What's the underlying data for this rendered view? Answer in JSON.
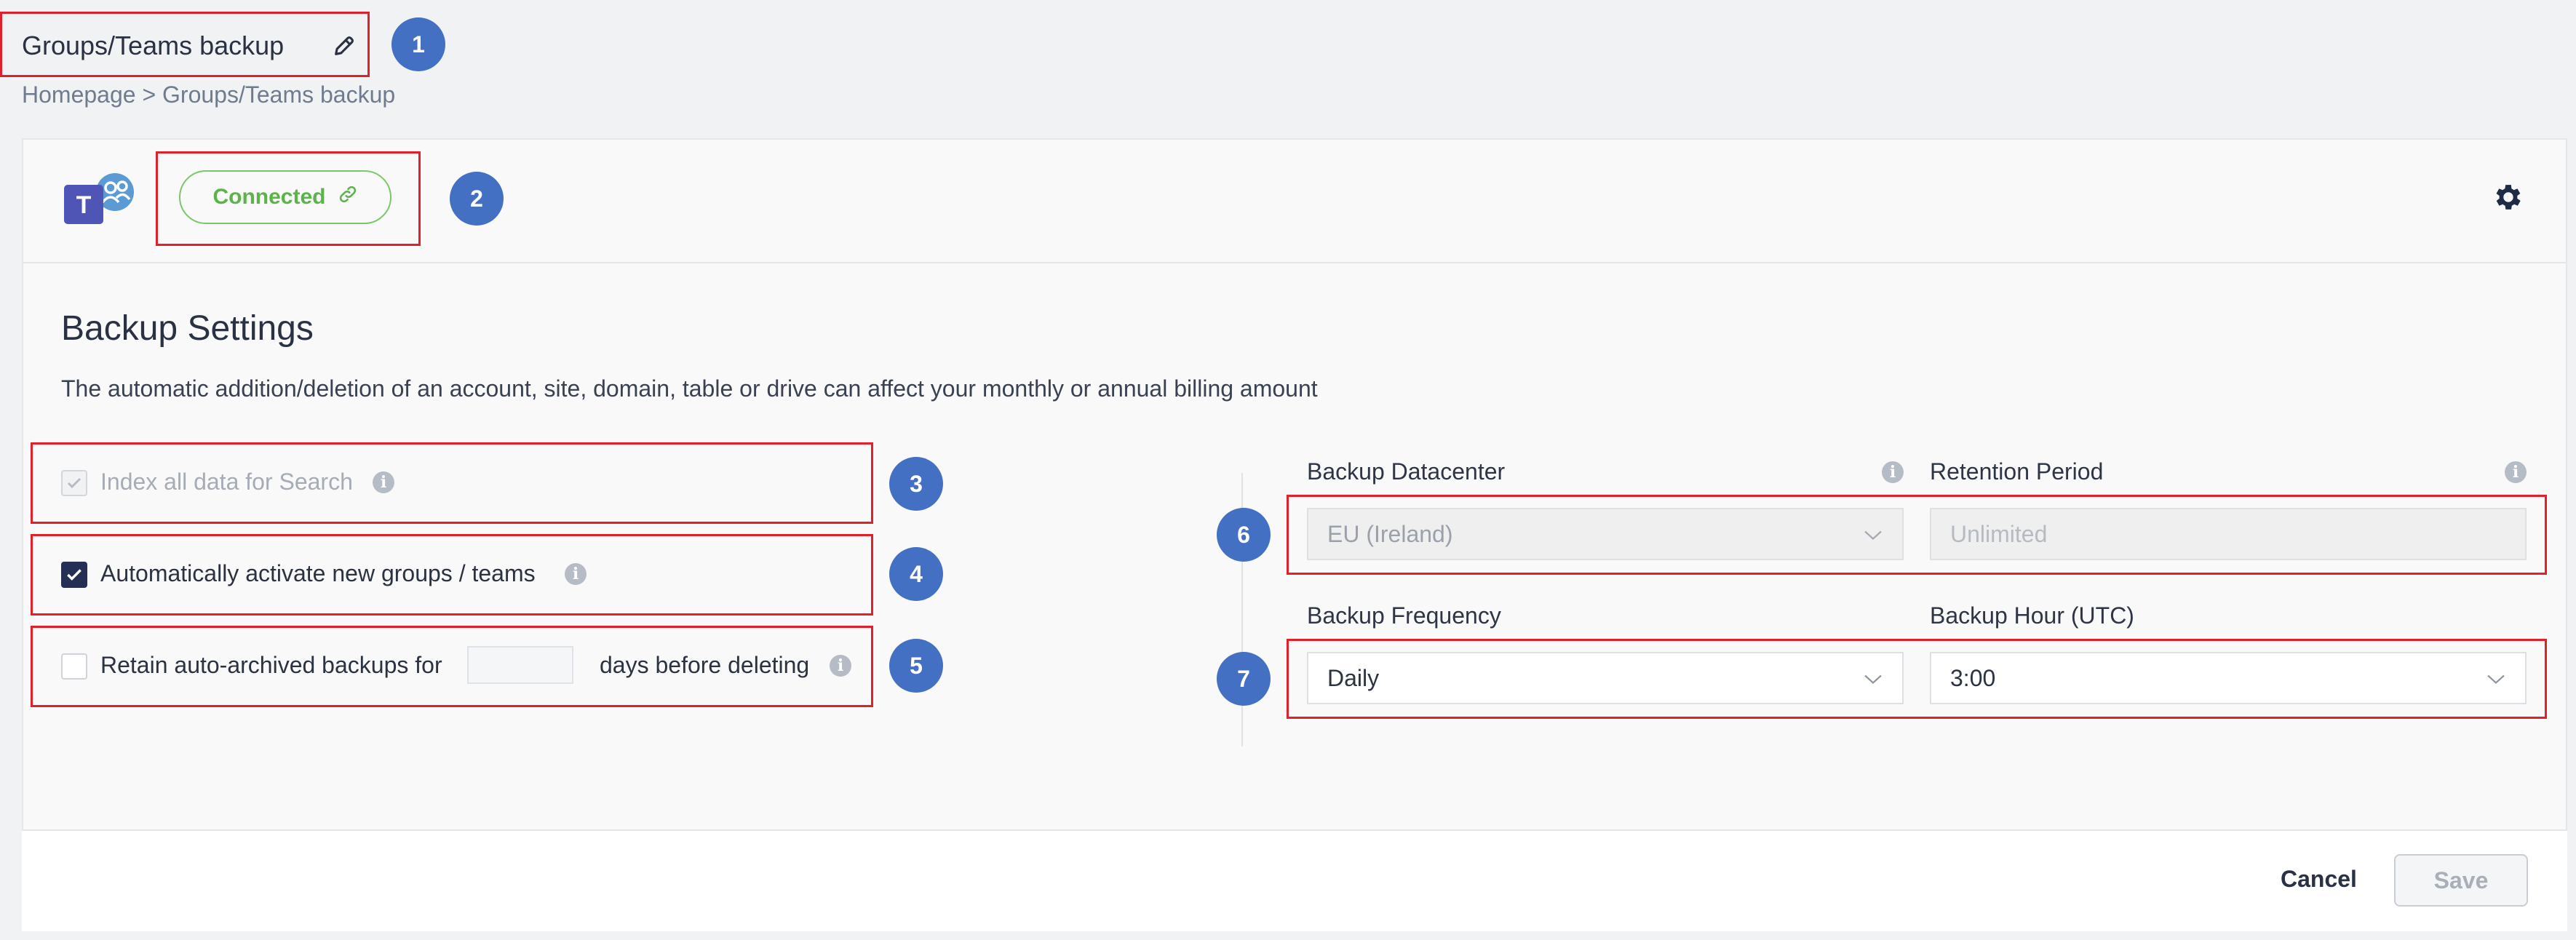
{
  "header": {
    "title": "Groups/Teams backup",
    "breadcrumb": "Homepage > Groups/Teams backup"
  },
  "connection": {
    "status_label": "Connected",
    "app_icon": "microsoft-teams-icon"
  },
  "settings": {
    "heading": "Backup Settings",
    "description": "The automatic addition/deletion of an account, site, domain, table or drive can affect your monthly or annual billing amount",
    "options": [
      {
        "label": "Index all data for Search",
        "checked": true,
        "disabled": true
      },
      {
        "label": "Automatically activate new groups / teams",
        "checked": true,
        "disabled": false
      },
      {
        "label_before": "Retain auto-archived backups for",
        "value": "",
        "label_after": "days before deleting",
        "checked": false,
        "disabled": false
      }
    ],
    "datacenter": {
      "label": "Backup Datacenter",
      "value": "EU (Ireland)"
    },
    "retention": {
      "label": "Retention Period",
      "value": "Unlimited"
    },
    "frequency": {
      "label": "Backup Frequency",
      "value": "Daily"
    },
    "hour": {
      "label": "Backup Hour (UTC)",
      "value": "3:00"
    }
  },
  "annotations": [
    "1",
    "2",
    "3",
    "4",
    "5",
    "6",
    "7"
  ],
  "footer": {
    "cancel_label": "Cancel",
    "save_label": "Save"
  },
  "colors": {
    "annotation_box": "#e0212a",
    "badge": "#4470c4",
    "connected": "#5bb34a",
    "checkbox_checked": "#252f56"
  }
}
